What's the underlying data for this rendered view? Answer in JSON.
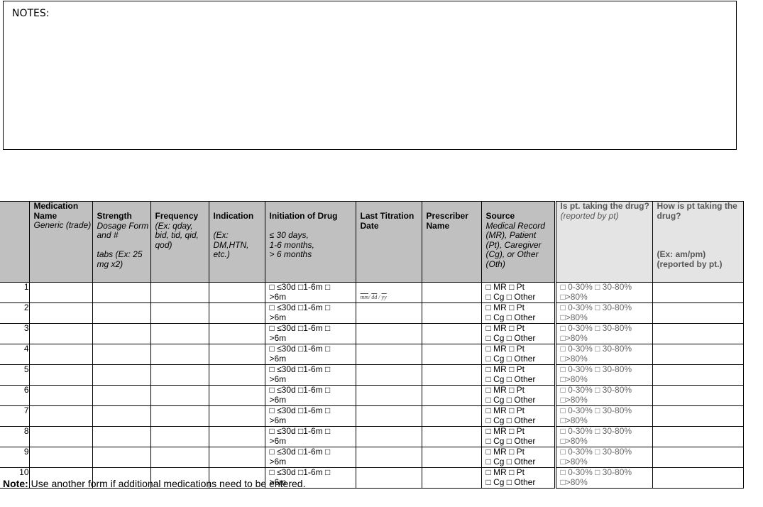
{
  "notes": {
    "label": "NOTES:"
  },
  "table": {
    "headers": {
      "med_name": {
        "title": "Medication Name",
        "sub": "Generic (trade)"
      },
      "strength": {
        "title": "Strength",
        "sub1": "Dosage Form and #",
        "sub2": "tabs (Ex: 25 mg x2)"
      },
      "frequency": {
        "title": "Frequency",
        "sub": "(Ex: qday, bid, tid, qid, qod)"
      },
      "indication": {
        "title": "Indication",
        "sub": "(Ex: DM,HTN, etc.)"
      },
      "initiation": {
        "title": "Initiation of Drug",
        "sub1": "≤ 30 days,",
        "sub2": "1-6 months,",
        "sub3": "> 6 months"
      },
      "titration": {
        "title": "Last Titration Date"
      },
      "prescriber": {
        "title": "Prescriber Name"
      },
      "source": {
        "title": "Source",
        "sub": "Medical Record (MR), Patient (Pt), Caregiver (Cg), or Other (Oth)"
      },
      "taking": {
        "title": "Is pt. taking the drug?",
        "sub": "(reported by pt)"
      },
      "how": {
        "title": "How is pt taking the drug?",
        "sub1": "(Ex: am/pm)",
        "sub2": "(reported by pt.)"
      }
    },
    "initiation_options": {
      "line1": "□ ≤30d □1-6m □",
      "line2": ">6m"
    },
    "date_format": {
      "mm": "mm",
      "dd": "dd",
      "yy": "yy"
    },
    "source_options": {
      "line1": "□ MR □ Pt",
      "line2": "□ Cg □ Other"
    },
    "taking_options": {
      "line1": "□ 0-30% □ 30-80%",
      "line2": "□>80%"
    },
    "rows": [
      "1",
      "2",
      "3",
      "4",
      "5",
      "6",
      "7",
      "8",
      "9",
      "10"
    ]
  },
  "footer": {
    "note_label": "Note:",
    "note_text": " Use another form if additional medications need to be entered."
  }
}
